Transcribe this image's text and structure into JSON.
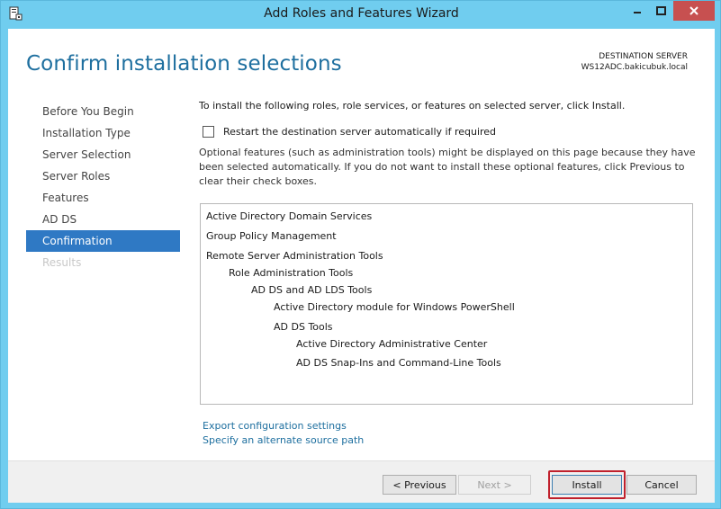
{
  "window": {
    "title": "Add Roles and Features Wizard"
  },
  "page": {
    "title": "Confirm installation selections",
    "destination_label": "DESTINATION SERVER",
    "destination_value": "WS12ADC.bakicubuk.local"
  },
  "nav": {
    "items": [
      {
        "label": "Before You Begin",
        "state": "normal"
      },
      {
        "label": "Installation Type",
        "state": "normal"
      },
      {
        "label": "Server Selection",
        "state": "normal"
      },
      {
        "label": "Server Roles",
        "state": "normal"
      },
      {
        "label": "Features",
        "state": "normal"
      },
      {
        "label": "AD DS",
        "state": "normal"
      },
      {
        "label": "Confirmation",
        "state": "active"
      },
      {
        "label": "Results",
        "state": "disabled"
      }
    ]
  },
  "content": {
    "intro": "To install the following roles, role services, or features on selected server, click Install.",
    "restart_label": "Restart the destination server automatically if required",
    "restart_checked": false,
    "optional_text": "Optional features (such as administration tools) might be displayed on this page because they have been selected automatically. If you do not want to install these optional features, click Previous to clear their check boxes.",
    "features": [
      {
        "label": "Active Directory Domain Services",
        "level": 0
      },
      {
        "label": "Group Policy Management",
        "level": 0
      },
      {
        "label": "Remote Server Administration Tools",
        "level": 0
      },
      {
        "label": "Role Administration Tools",
        "level": 1
      },
      {
        "label": "AD DS and AD LDS Tools",
        "level": 2
      },
      {
        "label": "Active Directory module for Windows PowerShell",
        "level": 3
      },
      {
        "label": "AD DS Tools",
        "level": 3
      },
      {
        "label": "Active Directory Administrative Center",
        "level": 4
      },
      {
        "label": "AD DS Snap-Ins and Command-Line Tools",
        "level": 4
      }
    ],
    "export_link": "Export configuration settings",
    "source_link": "Specify an alternate source path"
  },
  "footer": {
    "previous_label": "< Previous",
    "next_label": "Next >",
    "install_label": "Install",
    "cancel_label": "Cancel"
  },
  "colors": {
    "accent": "#2f79c4",
    "title_blue": "#1e6f9f",
    "highlight_red": "#c0202c"
  }
}
